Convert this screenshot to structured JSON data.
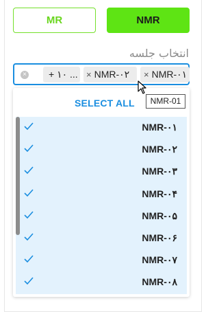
{
  "segments": {
    "mr_label": "MR",
    "nmr_label": "NMR"
  },
  "session_label": "انتخاب جلسه",
  "select": {
    "chips": [
      {
        "label": "NMR-۰۱",
        "remove": "×"
      },
      {
        "label": "NMR-۰۲",
        "remove": "×"
      }
    ],
    "more_label": "+ ۱۰ ...",
    "clear_icon": "×"
  },
  "tooltip": "NMR-01",
  "dropdown": {
    "select_all_label": "SELECT ALL",
    "options": [
      "NMR-۰۱",
      "NMR-۰۲",
      "NMR-۰۳",
      "NMR-۰۴",
      "NMR-۰۵",
      "NMR-۰۶",
      "NMR-۰۷",
      "NMR-۰۸"
    ]
  },
  "colors": {
    "accent_green": "#5ee414",
    "accent_blue": "#1a8ee0",
    "selected_row_bg": "#e3f2fd"
  }
}
